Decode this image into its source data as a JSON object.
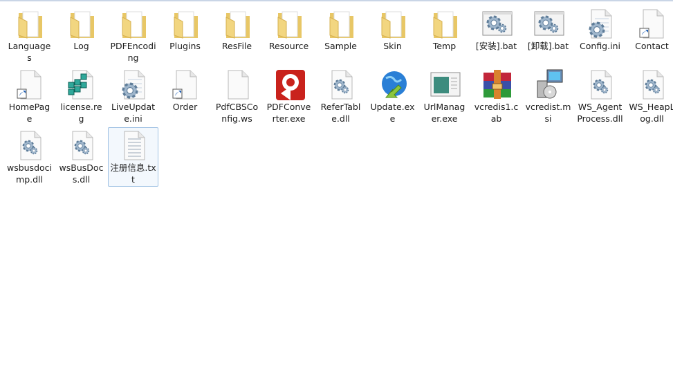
{
  "items": [
    {
      "name": "Languages",
      "icon": "folder"
    },
    {
      "name": "Log",
      "icon": "folder"
    },
    {
      "name": "PDFEncoding",
      "icon": "folder"
    },
    {
      "name": "Plugins",
      "icon": "folder"
    },
    {
      "name": "ResFile",
      "icon": "folder"
    },
    {
      "name": "Resource",
      "icon": "folder"
    },
    {
      "name": "Sample",
      "icon": "folder"
    },
    {
      "name": "Skin",
      "icon": "folder"
    },
    {
      "name": "Temp",
      "icon": "folder"
    },
    {
      "name": "[安装].bat",
      "icon": "batch"
    },
    {
      "name": "[卸载].bat",
      "icon": "batch"
    },
    {
      "name": "Config.ini",
      "icon": "settings-file"
    },
    {
      "name": "Contact",
      "icon": "shortcut"
    },
    {
      "name": "HomePage",
      "icon": "shortcut"
    },
    {
      "name": "license.reg",
      "icon": "registry"
    },
    {
      "name": "LiveUpdate.ini",
      "icon": "settings-file"
    },
    {
      "name": "Order",
      "icon": "shortcut"
    },
    {
      "name": "PdfCBSConfig.ws",
      "icon": "blank-file"
    },
    {
      "name": "PDFConverter.exe",
      "icon": "pdf-converter"
    },
    {
      "name": "ReferTable.dll",
      "icon": "dll"
    },
    {
      "name": "Update.exe",
      "icon": "globe"
    },
    {
      "name": "UrlManager.exe",
      "icon": "window"
    },
    {
      "name": "vcredis1.cab",
      "icon": "archive"
    },
    {
      "name": "vcredist.msi",
      "icon": "installer"
    },
    {
      "name": "WS_AgentProcess.dll",
      "icon": "dll"
    },
    {
      "name": "WS_HeapLog.dll",
      "icon": "dll"
    },
    {
      "name": "wsbusdocimp.dll",
      "icon": "dll"
    },
    {
      "name": "wsBusDocs.dll",
      "icon": "dll"
    },
    {
      "name": "注册信息.txt",
      "icon": "text-file",
      "selected": true
    }
  ]
}
